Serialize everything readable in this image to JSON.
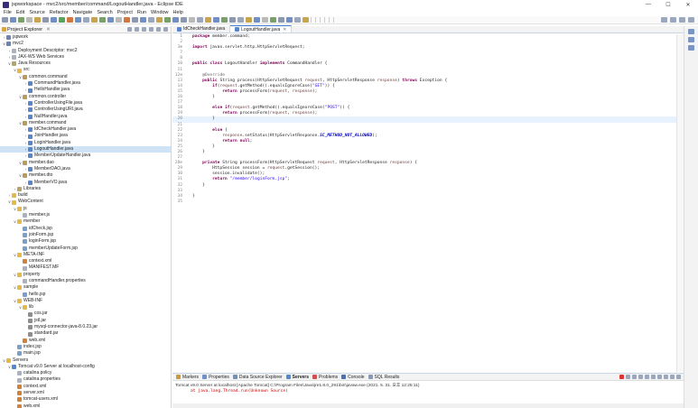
{
  "window": {
    "title": "jspworkspace - mvc2/src/member/command/LogoutHandler.java - Eclipse IDE",
    "min": "—",
    "max": "☐",
    "close": "✕"
  },
  "menu": [
    "File",
    "Edit",
    "Source",
    "Refactor",
    "Navigate",
    "Search",
    "Project",
    "Run",
    "Window",
    "Help"
  ],
  "explorer": {
    "title": "Project Explorer",
    "close": "✕",
    "items": [
      {
        "indent": 0,
        "tw": ">",
        "icon": "proj",
        "label": "jspwork"
      },
      {
        "indent": 0,
        "tw": "v",
        "icon": "proj",
        "label": "mvc2"
      },
      {
        "indent": 1,
        "tw": ">",
        "icon": "file",
        "label": "Deployment Descriptor: mvc2"
      },
      {
        "indent": 1,
        "tw": ">",
        "icon": "file",
        "label": "JAX-WS Web Services"
      },
      {
        "indent": 1,
        "tw": "v",
        "icon": "lib",
        "label": "Java Resources"
      },
      {
        "indent": 2,
        "tw": "v",
        "icon": "folder",
        "label": "src"
      },
      {
        "indent": 3,
        "tw": "v",
        "icon": "pkg",
        "label": "common.command"
      },
      {
        "indent": 4,
        "tw": ">",
        "icon": "java",
        "label": "CommandHandler.java"
      },
      {
        "indent": 4,
        "tw": ">",
        "icon": "java",
        "label": "HelloHandler.java"
      },
      {
        "indent": 3,
        "tw": "v",
        "icon": "pkg",
        "label": "common.controller"
      },
      {
        "indent": 4,
        "tw": ">",
        "icon": "java",
        "label": "ControllerUsingFile.java"
      },
      {
        "indent": 4,
        "tw": ">",
        "icon": "java",
        "label": "ControllerUsingURI.java"
      },
      {
        "indent": 4,
        "tw": ">",
        "icon": "java",
        "label": "NullHandler.java"
      },
      {
        "indent": 3,
        "tw": "v",
        "icon": "pkg",
        "label": "member.command"
      },
      {
        "indent": 4,
        "tw": ">",
        "icon": "java",
        "label": "IdCheckHandler.java"
      },
      {
        "indent": 4,
        "tw": ">",
        "icon": "java",
        "label": "JoinHandler.java"
      },
      {
        "indent": 4,
        "tw": ">",
        "icon": "java",
        "label": "LoginHandler.java"
      },
      {
        "indent": 4,
        "tw": ">",
        "icon": "java",
        "label": "LogoutHandler.java",
        "selected": true
      },
      {
        "indent": 4,
        "tw": ">",
        "icon": "java",
        "label": "MemberUpdateHandler.java"
      },
      {
        "indent": 3,
        "tw": "v",
        "icon": "pkg",
        "label": "member.dao"
      },
      {
        "indent": 4,
        "tw": ">",
        "icon": "java",
        "label": "MemberDAO.java"
      },
      {
        "indent": 3,
        "tw": "v",
        "icon": "pkg",
        "label": "member.dto"
      },
      {
        "indent": 4,
        "tw": ">",
        "icon": "java",
        "label": "MemberVO.java"
      },
      {
        "indent": 2,
        "tw": ">",
        "icon": "lib",
        "label": "Libraries"
      },
      {
        "indent": 1,
        "tw": ">",
        "icon": "folder",
        "label": "build"
      },
      {
        "indent": 1,
        "tw": "v",
        "icon": "folder",
        "label": "WebContent"
      },
      {
        "indent": 2,
        "tw": "v",
        "icon": "folder",
        "label": "js"
      },
      {
        "indent": 3,
        "tw": "",
        "icon": "file",
        "label": "member.js"
      },
      {
        "indent": 2,
        "tw": "v",
        "icon": "folder",
        "label": "member"
      },
      {
        "indent": 3,
        "tw": "",
        "icon": "jsp",
        "label": "idCheck.jsp"
      },
      {
        "indent": 3,
        "tw": "",
        "icon": "jsp",
        "label": "joinForm.jsp"
      },
      {
        "indent": 3,
        "tw": "",
        "icon": "jsp",
        "label": "loginForm.jsp"
      },
      {
        "indent": 3,
        "tw": "",
        "icon": "jsp",
        "label": "memberUpdateForm.jsp"
      },
      {
        "indent": 2,
        "tw": "v",
        "icon": "folder",
        "label": "META-INF"
      },
      {
        "indent": 3,
        "tw": "",
        "icon": "xml",
        "label": "context.xml"
      },
      {
        "indent": 3,
        "tw": "",
        "icon": "file",
        "label": "MANIFEST.MF"
      },
      {
        "indent": 2,
        "tw": "v",
        "icon": "folder",
        "label": "property"
      },
      {
        "indent": 3,
        "tw": "",
        "icon": "file",
        "label": "commandHandler.properties"
      },
      {
        "indent": 2,
        "tw": "v",
        "icon": "folder",
        "label": "sample"
      },
      {
        "indent": 3,
        "tw": "",
        "icon": "jsp",
        "label": "hello.jsp"
      },
      {
        "indent": 2,
        "tw": "v",
        "icon": "folder",
        "label": "WEB-INF"
      },
      {
        "indent": 3,
        "tw": "v",
        "icon": "folder",
        "label": "lib"
      },
      {
        "indent": 4,
        "tw": "",
        "icon": "jar",
        "label": "cos.jar"
      },
      {
        "indent": 4,
        "tw": "",
        "icon": "jar",
        "label": "jstl.jar"
      },
      {
        "indent": 4,
        "tw": "",
        "icon": "jar",
        "label": "mysql-connector-java-8.0.23.jar"
      },
      {
        "indent": 4,
        "tw": "",
        "icon": "jar",
        "label": "standard.jar"
      },
      {
        "indent": 3,
        "tw": "",
        "icon": "xml",
        "label": "web.xml"
      },
      {
        "indent": 2,
        "tw": "",
        "icon": "jsp",
        "label": "index.jsp"
      },
      {
        "indent": 2,
        "tw": "",
        "icon": "jsp",
        "label": "main.jsp"
      },
      {
        "indent": 0,
        "tw": "v",
        "icon": "folder",
        "label": "Servers"
      },
      {
        "indent": 1,
        "tw": "v",
        "icon": "srv",
        "label": "Tomcat v9.0 Server at localhost-config"
      },
      {
        "indent": 2,
        "tw": "",
        "icon": "file",
        "label": "catalina.policy"
      },
      {
        "indent": 2,
        "tw": "",
        "icon": "file",
        "label": "catalina.properties"
      },
      {
        "indent": 2,
        "tw": "",
        "icon": "xml",
        "label": "context.xml"
      },
      {
        "indent": 2,
        "tw": "",
        "icon": "xml",
        "label": "server.xml"
      },
      {
        "indent": 2,
        "tw": "",
        "icon": "xml",
        "label": "tomcat-users.xml"
      },
      {
        "indent": 2,
        "tw": "",
        "icon": "xml",
        "label": "web.xml"
      }
    ]
  },
  "editor": {
    "tabs": [
      {
        "label": "IdCheckHandler.java",
        "active": false
      },
      {
        "label": "LogoutHandler.java",
        "active": true,
        "close": "✕"
      }
    ],
    "lines": [
      {
        "n": "1",
        "t": "package member.command;"
      },
      {
        "n": "2",
        "t": ""
      },
      {
        "n": "3⊕",
        "t": "import javax.servlet.http.HttpServletRequest;"
      },
      {
        "n": "7",
        "t": ""
      },
      {
        "n": "8",
        "t": ""
      },
      {
        "n": "10",
        "t": "public class LogoutHandler implements CommandHandler {"
      },
      {
        "n": "11",
        "t": ""
      },
      {
        "n": "12⊖",
        "t": "    @Override"
      },
      {
        "n": "13",
        "t": "    public String process(HttpServletRequest request, HttpServletResponse response) throws Exception {"
      },
      {
        "n": "14",
        "t": "        if(request.getMethod().equalsIgnoreCase(\"GET\")) {"
      },
      {
        "n": "15",
        "t": "            return processForm(request, response);"
      },
      {
        "n": "16",
        "t": "        }"
      },
      {
        "n": "17",
        "t": ""
      },
      {
        "n": "18",
        "t": "        else if(request.getMethod().equalsIgnoreCase(\"POST\")) {"
      },
      {
        "n": "19",
        "t": "            return processForm(request, response);"
      },
      {
        "n": "20",
        "t": "        }",
        "hl": true
      },
      {
        "n": "21",
        "t": ""
      },
      {
        "n": "22",
        "t": "        else {"
      },
      {
        "n": "23",
        "t": "            response.setStatus(HttpServletResponse.SC_METHOD_NOT_ALLOWED);"
      },
      {
        "n": "24",
        "t": "            return null;"
      },
      {
        "n": "25",
        "t": "        }"
      },
      {
        "n": "26",
        "t": "    }"
      },
      {
        "n": "27",
        "t": ""
      },
      {
        "n": "28⊖",
        "t": "    private String processForm(HttpServletRequest request, HttpServletResponse response) {"
      },
      {
        "n": "29",
        "t": "        HttpSession session = request.getSession();"
      },
      {
        "n": "30",
        "t": "        session.invalidate();"
      },
      {
        "n": "31",
        "t": "        return \"/member/loginForm.jsp\";"
      },
      {
        "n": "32",
        "t": "    }"
      },
      {
        "n": "33",
        "t": ""
      },
      {
        "n": "34",
        "t": "}"
      },
      {
        "n": "35",
        "t": ""
      }
    ]
  },
  "console": {
    "tabs": [
      "Markers",
      "Properties",
      "Data Source Explorer",
      "Servers",
      "Problems",
      "Console",
      "SQL Results"
    ],
    "active_tab": "Servers",
    "info": "Tomcat v9.0 Server at localhost [Apache Tomcat] C:\\Program Files\\Java\\jre1.8.0_291\\bin\\javaw.exe  (2021. 5. 31. 오후 12:25:11)",
    "error": "at java.lang.Thread.run(Unknown Source)"
  },
  "colors": {
    "accent": "#3c79d0",
    "keyword": "#7f0055",
    "string": "#2a00ff",
    "annotation": "#646464",
    "constant": "#0000c0"
  }
}
